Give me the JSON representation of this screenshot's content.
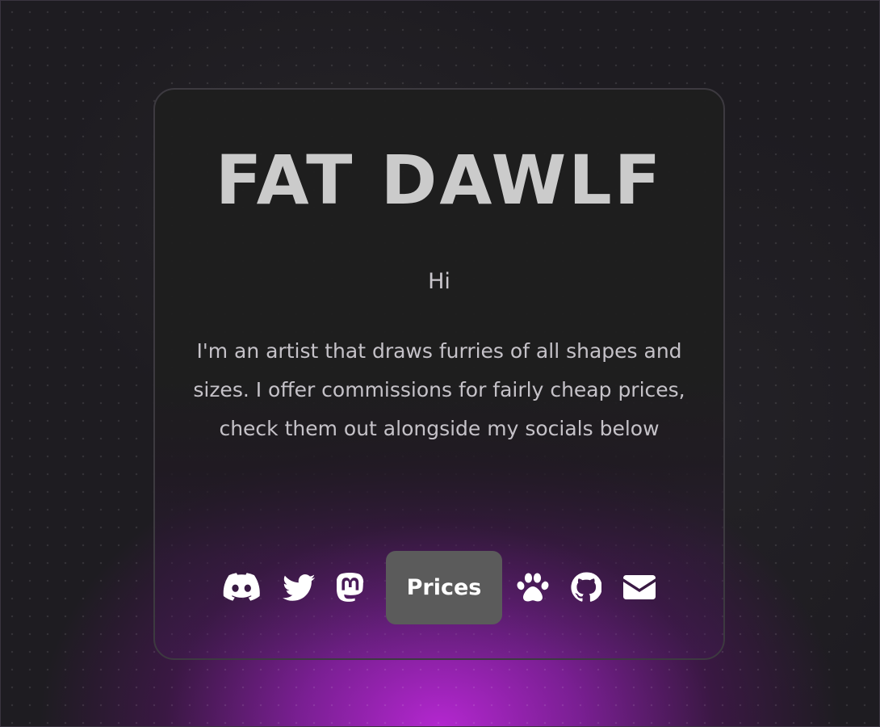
{
  "page": {
    "title": "FAT DAWLF",
    "greeting": "Hi",
    "bio": "I'm an artist that draws furries of all shapes and sizes. I offer commissions for fairly cheap prices, check them out alongside my socials below"
  },
  "links": {
    "discord": {
      "icon": "discord-icon"
    },
    "twitter": {
      "icon": "twitter-icon"
    },
    "mastodon": {
      "icon": "mastodon-icon"
    },
    "prices": {
      "label": "Prices"
    },
    "furaffinity": {
      "icon": "paw-icon"
    },
    "github": {
      "icon": "github-icon"
    },
    "email": {
      "icon": "envelope-icon"
    }
  },
  "colors": {
    "background": "#1e1c21",
    "glow": "#b327cf",
    "card_border": "#3d3a40",
    "title": "#cbcbcb",
    "text": "#c5c2c8",
    "button_bg": "#5b5b5b",
    "icon": "#ffffff"
  }
}
